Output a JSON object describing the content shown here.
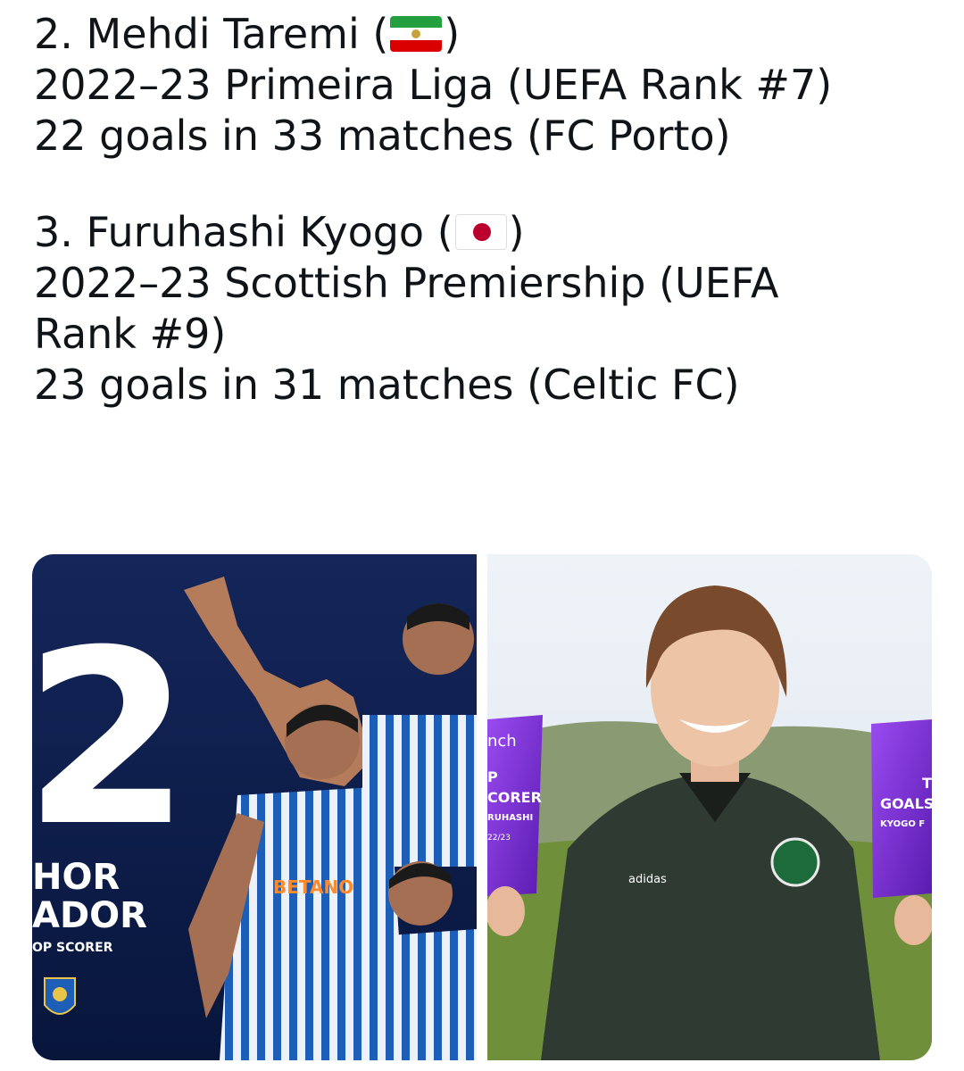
{
  "tweet": {
    "lines": [
      "2. Mehdi Taremi (",
      ")",
      "2022–23 Primeira Liga (UEFA Rank #7)",
      "22 goals in 33 matches (FC Porto)",
      "3. Furuhashi Kyogo (",
      ")",
      "2022–23 Scottish Premiership (UEFA",
      "Rank #9)",
      "23 goals in 31 matches (Celtic FC)"
    ],
    "flag_1": "iran-flag-icon",
    "flag_2": "japan-flag-icon"
  },
  "media": {
    "left": {
      "big_number": "2",
      "caption_1": "HOR",
      "caption_2": "ADOR",
      "caption_3": "OP SCORER",
      "sponsor": "BETANO"
    },
    "right": {
      "award_left_brand": "nch",
      "award_left_1": "P",
      "award_left_2": "CORER",
      "award_left_3": "RUHASHI",
      "award_left_4": "22/23",
      "award_right_1": "T",
      "award_right_2": "GOALS",
      "award_right_3": "KYOGO F",
      "kit_brand": "adidas"
    }
  },
  "colors": {
    "text": "#0f1419",
    "porto_bg": "#0b1c4a",
    "porto_blue": "#1d5fb8",
    "celtic_green": "#2f3a33",
    "award_purple": "#7b2fd0",
    "sky": "#e8eef5",
    "grass": "#6f8f3a"
  }
}
